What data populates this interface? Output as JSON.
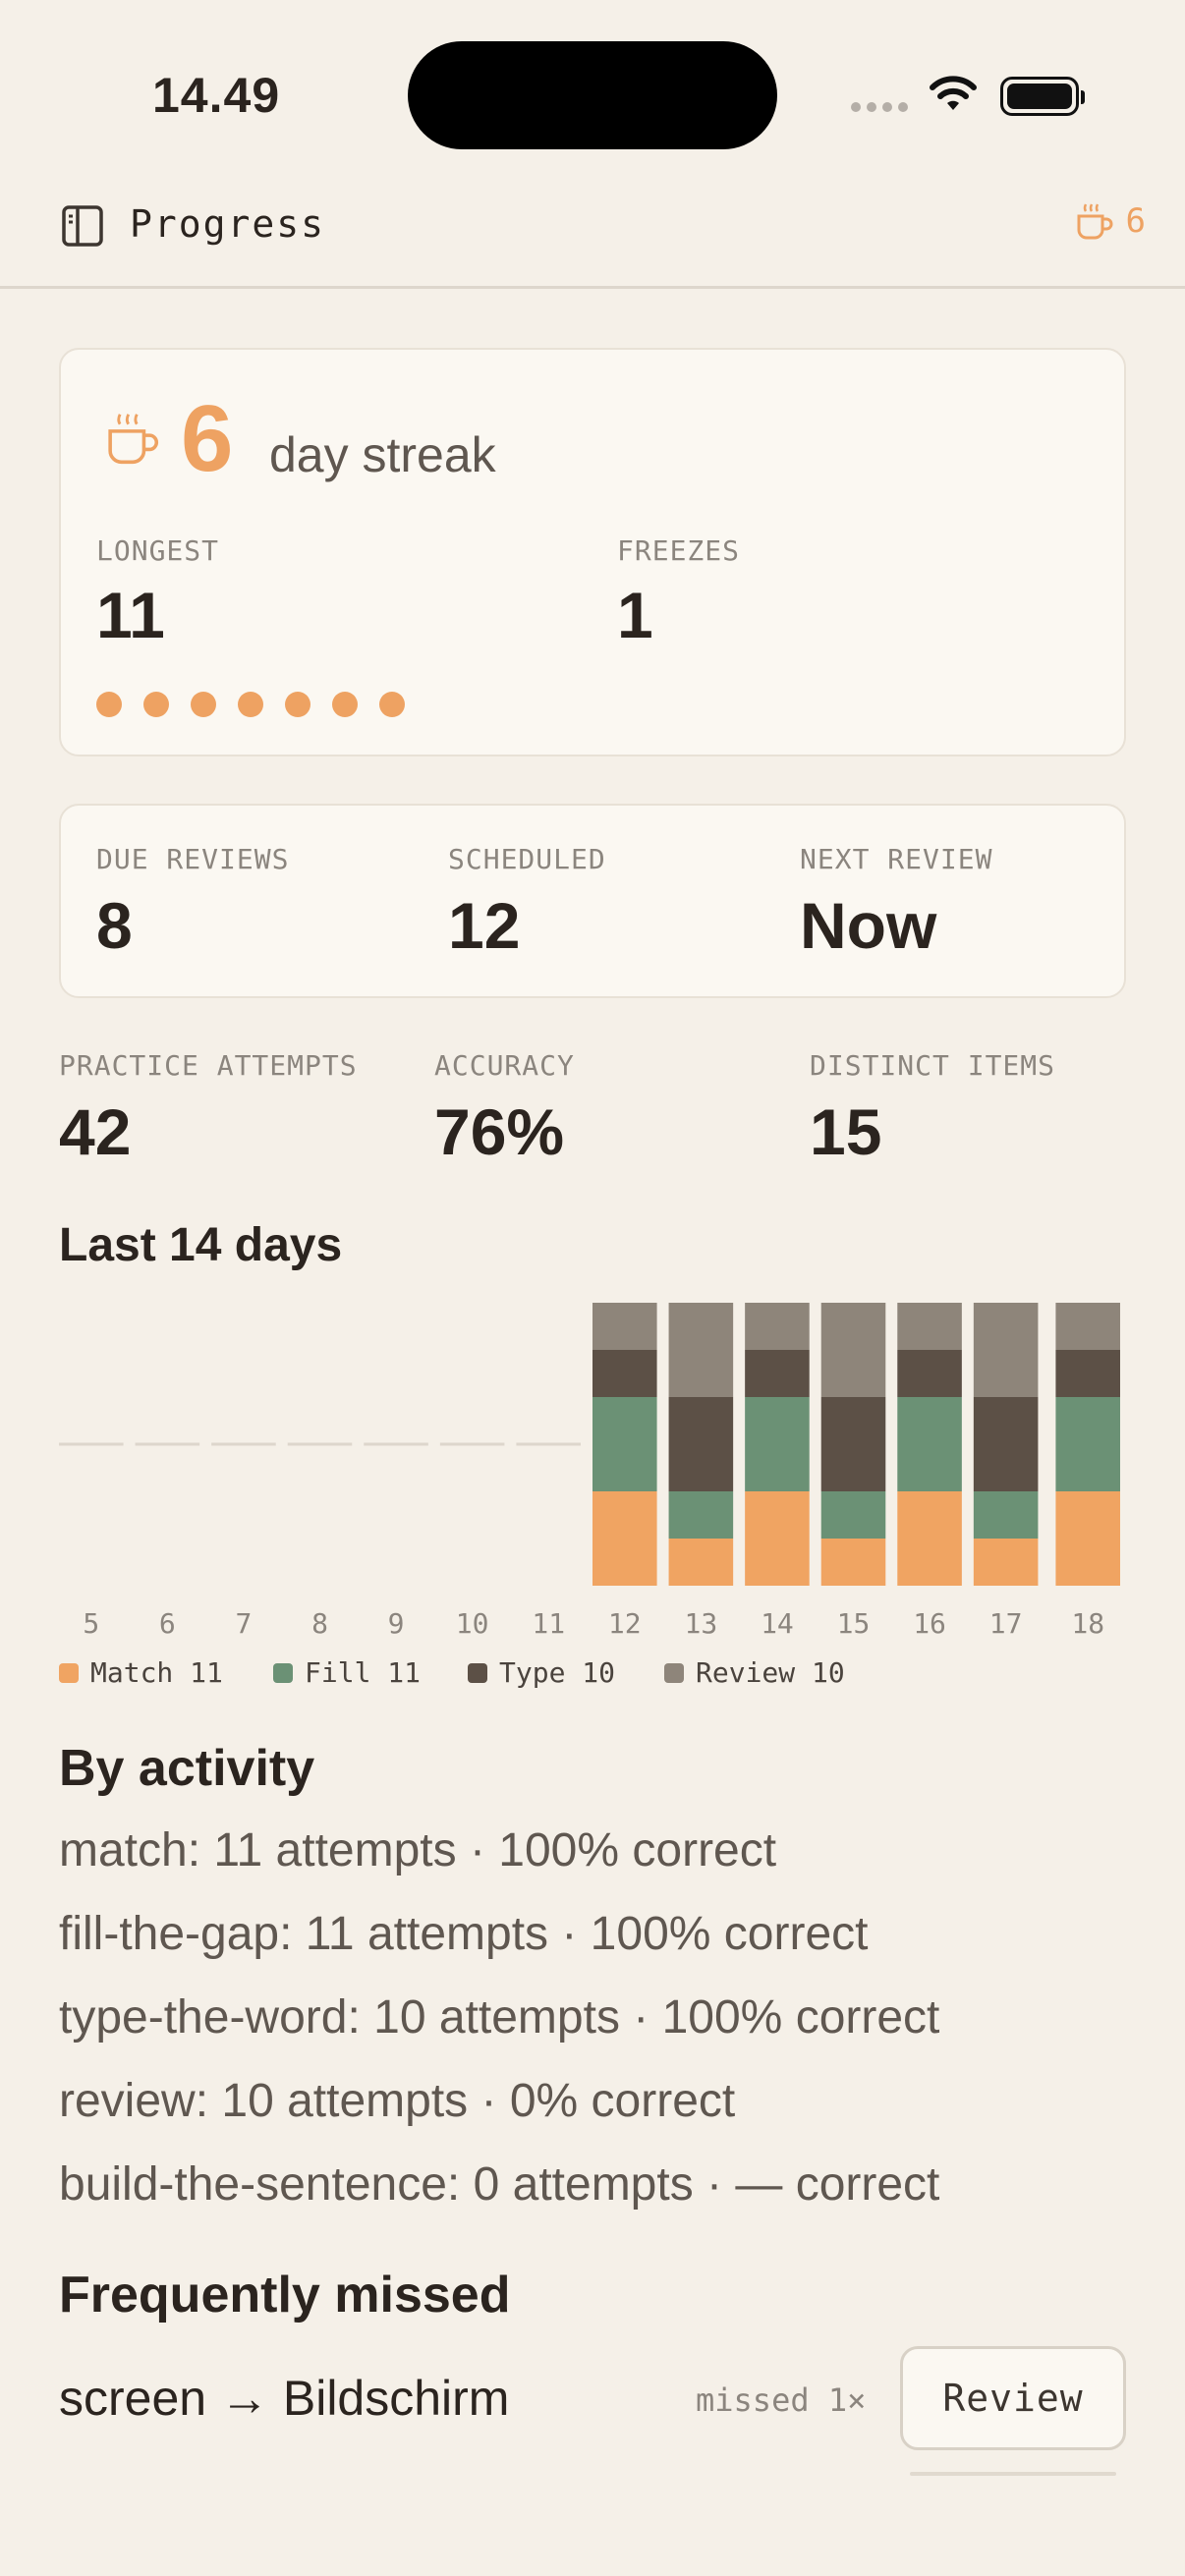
{
  "status_bar": {
    "time": "14.49"
  },
  "nav": {
    "title": "Progress",
    "streak_count": "6"
  },
  "streak_card": {
    "number": "6",
    "label": "day streak",
    "longest_label": "LONGEST",
    "longest_value": "11",
    "freezes_label": "FREEZES",
    "freezes_value": "1",
    "dots_filled": 7
  },
  "reviews_card": {
    "due_label": "DUE REVIEWS",
    "due_value": "8",
    "scheduled_label": "SCHEDULED",
    "scheduled_value": "12",
    "next_label": "NEXT REVIEW",
    "next_value": "Now"
  },
  "stats": {
    "attempts_label": "PRACTICE ATTEMPTS",
    "attempts_value": "42",
    "accuracy_label": "ACCURACY",
    "accuracy_value": "76%",
    "distinct_label": "DISTINCT ITEMS",
    "distinct_value": "15"
  },
  "chart_title": "Last 14 days",
  "chart_data": {
    "type": "bar",
    "stacked": true,
    "categories": [
      "5",
      "6",
      "7",
      "8",
      "9",
      "10",
      "11",
      "12",
      "13",
      "14",
      "15",
      "16",
      "17",
      "18"
    ],
    "series": [
      {
        "name": "Match",
        "color": "#f0a462",
        "values": [
          0,
          0,
          0,
          0,
          0,
          0,
          0,
          2,
          1,
          2,
          1,
          2,
          1,
          2
        ]
      },
      {
        "name": "Fill",
        "color": "#6b9175",
        "values": [
          0,
          0,
          0,
          0,
          0,
          0,
          0,
          2,
          1,
          2,
          1,
          2,
          1,
          2
        ]
      },
      {
        "name": "Type",
        "color": "#5c5046",
        "values": [
          0,
          0,
          0,
          0,
          0,
          0,
          0,
          1,
          2,
          1,
          2,
          1,
          2,
          1
        ]
      },
      {
        "name": "Review",
        "color": "#8e857a",
        "values": [
          0,
          0,
          0,
          0,
          0,
          0,
          0,
          1,
          2,
          1,
          2,
          1,
          2,
          1
        ]
      }
    ],
    "ylim": [
      0,
      6
    ]
  },
  "legend": [
    {
      "label": "Match 11",
      "color": "#f0a462"
    },
    {
      "label": "Fill 11",
      "color": "#6b9175"
    },
    {
      "label": "Type 10",
      "color": "#5c5046"
    },
    {
      "label": "Review 10",
      "color": "#8e857a"
    }
  ],
  "by_activity": {
    "title": "By activity",
    "rows": [
      "match: 11 attempts · 100% correct",
      "fill-the-gap: 11 attempts · 100% correct",
      "type-the-word: 10 attempts · 100% correct",
      "review: 10 attempts · 0% correct",
      "build-the-sentence: 0 attempts · — correct"
    ]
  },
  "frequently_missed": {
    "title": "Frequently missed",
    "items": [
      {
        "word": "screen → Bildschirm",
        "missed": "missed 1×",
        "button": "Review"
      }
    ]
  },
  "colors": {
    "accent": "#eea262",
    "background": "#f5f0e8",
    "card": "#fbf8f2"
  },
  "icons": {
    "sidebar": "sidebar-icon",
    "streak": "coffee-cup-icon"
  }
}
